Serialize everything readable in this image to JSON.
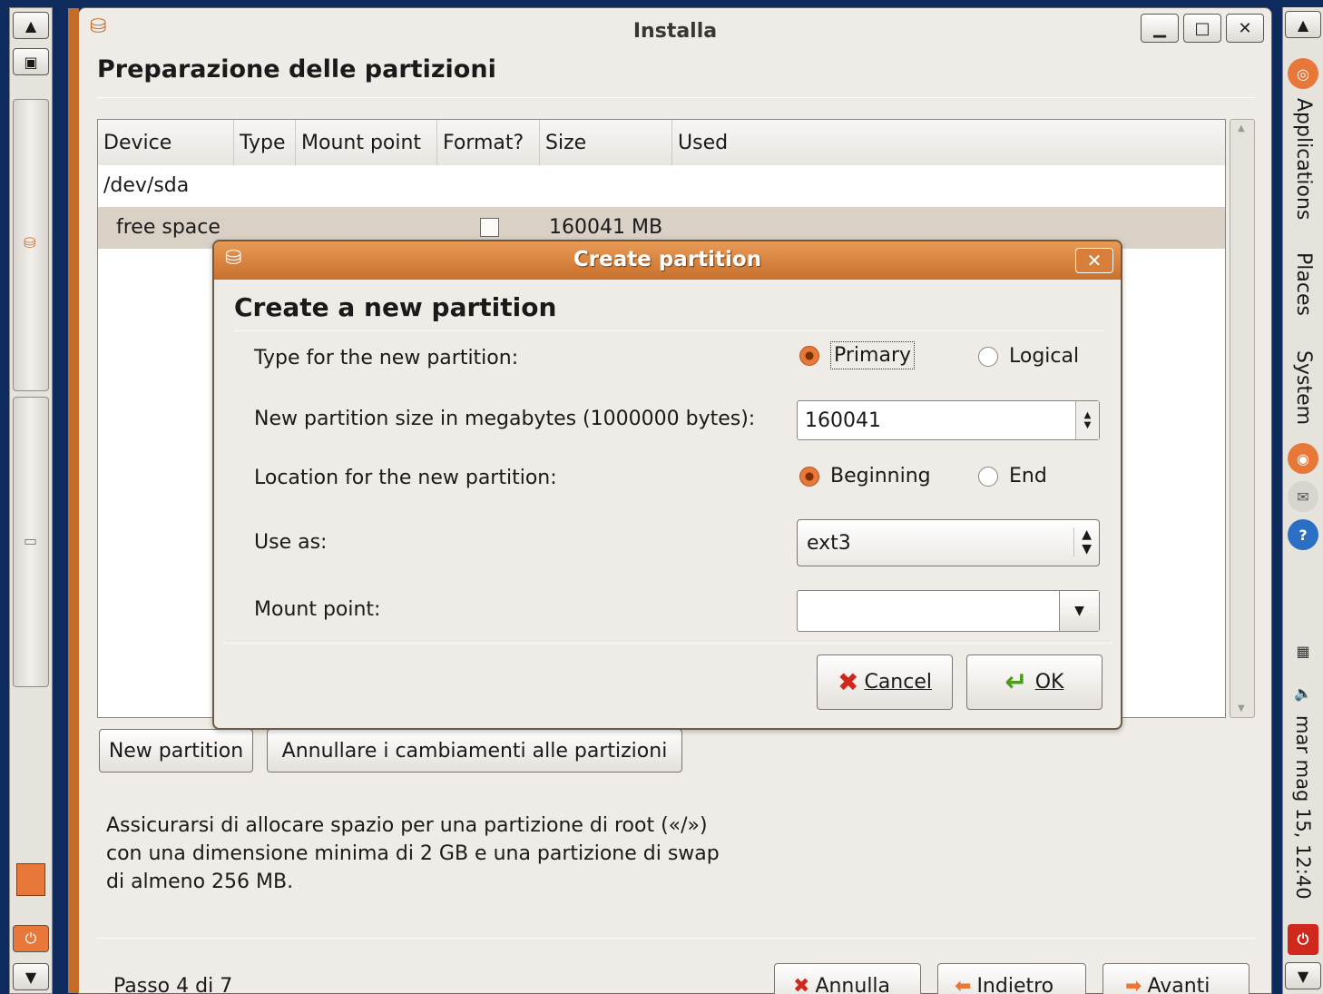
{
  "window": {
    "title": "Installa",
    "heading": "Preparazione delle partizioni",
    "minimize_icon": "minimize-icon",
    "maximize_icon": "maximize-icon",
    "close_icon": "close-icon"
  },
  "table": {
    "columns": [
      "Device",
      "Type",
      "Mount point",
      "Format?",
      "Size",
      "Used"
    ],
    "rows": [
      {
        "device": "/dev/sda"
      },
      {
        "device": "free space",
        "format_checked": false,
        "size": "160041 MB"
      }
    ]
  },
  "actions": {
    "new_partition": "New partition",
    "undo_changes": "Annullare i cambiamenti alle partizioni"
  },
  "note": "Assicurarsi di allocare spazio per una partizione di root («/») con una dimensione minima di 2 GB e una partizione di swap di almeno 256 MB.",
  "footer": {
    "step": "Passo 4 di 7",
    "cancel": "Annulla",
    "back": "Indietro",
    "forward": "Avanti"
  },
  "dialog": {
    "title": "Create partition",
    "heading": "Create a new partition",
    "type_label": "Type for the new partition:",
    "type_primary": "Primary",
    "type_logical": "Logical",
    "type_selected": "Primary",
    "size_label": "New partition size in megabytes (1000000 bytes):",
    "size_value": "160041",
    "location_label": "Location for the new partition:",
    "location_beginning": "Beginning",
    "location_end": "End",
    "location_selected": "Beginning",
    "use_as_label": "Use as:",
    "use_as_value": "ext3",
    "mount_label": "Mount point:",
    "mount_value": "",
    "cancel": "Cancel",
    "ok": "OK"
  },
  "top_panel": {
    "applications": "Applications",
    "places": "Places",
    "system": "System",
    "clock": "mar mag 15, 12:40"
  },
  "colors": {
    "accent_orange": "#c8712e",
    "desktop_blue": "#0f2a5c"
  }
}
